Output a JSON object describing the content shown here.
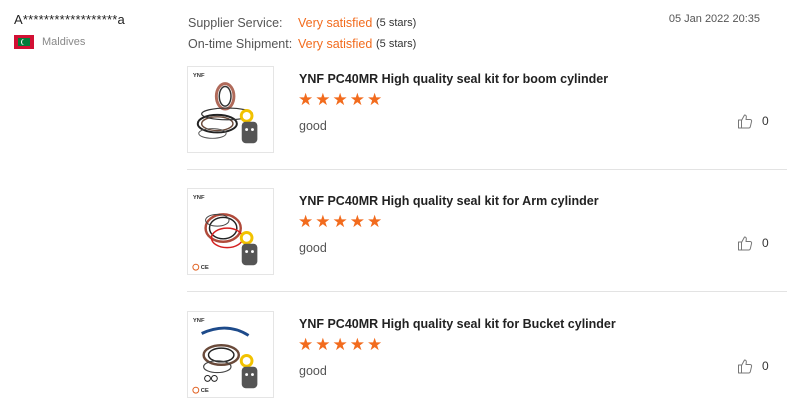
{
  "reviewer": {
    "name": "A******************a",
    "country": "Maldives"
  },
  "ratings": [
    {
      "label": "Supplier Service:",
      "value": "Very satisfied",
      "stars": "(5 stars)"
    },
    {
      "label": "On-time Shipment:",
      "value": "Very satisfied",
      "stars": "(5 stars)"
    }
  ],
  "date": "05 Jan 2022 20:35",
  "products": [
    {
      "title": "YNF PC40MR High quality seal kit for boom cylinder",
      "rating": 5,
      "comment": "good",
      "likes": "0"
    },
    {
      "title": "YNF PC40MR High quality seal kit for Arm cylinder",
      "rating": 5,
      "comment": "good",
      "likes": "0"
    },
    {
      "title": "YNF PC40MR High quality seal kit for Bucket cylinder",
      "rating": 5,
      "comment": "good",
      "likes": "0"
    }
  ],
  "icons": {
    "star": "star-icon",
    "like": "thumbs-up-icon",
    "flag": "maldives-flag-icon"
  },
  "colors": {
    "accent": "#f26b1d"
  }
}
